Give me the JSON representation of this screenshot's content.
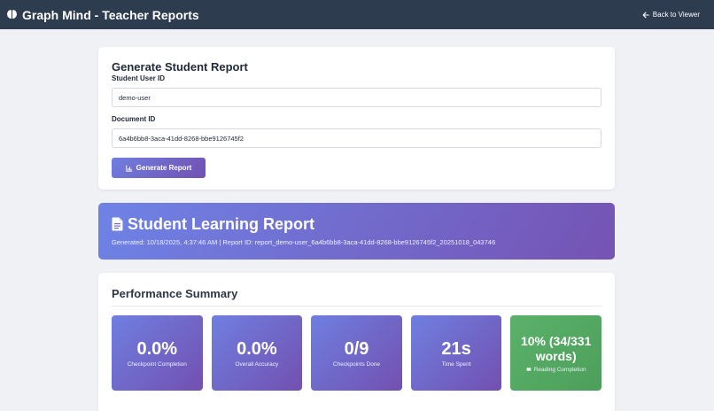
{
  "header": {
    "title": "Graph Mind - Teacher Reports",
    "back_label": "Back to Viewer",
    "brand_icon": "brain-icon",
    "back_icon": "arrow-left-icon"
  },
  "generate": {
    "title": "Generate Student Report",
    "user_label": "Student User ID",
    "user_value": "demo-user",
    "doc_label": "Document ID",
    "doc_value": "6a4b6bb8-3aca-41dd-8268-bbe9126745f2",
    "button_label": "Generate Report",
    "button_icon": "chart-icon"
  },
  "report": {
    "title": "Student Learning Report",
    "icon": "document-icon",
    "meta": "Generated: 10/18/2025, 4:37:46 AM | Report ID: report_demo-user_6a4b6bb8-3aca-41dd-8268-bbe9126745f2_20251018_043746"
  },
  "performance": {
    "title": "Performance Summary",
    "stats": [
      {
        "value": "0.0%",
        "label": "Checkpoint Completion"
      },
      {
        "value": "0.0%",
        "label": "Overall Accuracy"
      },
      {
        "value": "0/9",
        "label": "Checkpoints Done"
      },
      {
        "value": "21s",
        "label": "Time Spent"
      },
      {
        "value": "10% (34/331 words)",
        "label": "Reading Completion",
        "icon": "book-icon"
      }
    ]
  },
  "colors": {
    "topbar": "#2e3c4f",
    "accent_start": "#6f7fe0",
    "accent_end": "#7250b0",
    "success": "#5cb16a"
  }
}
